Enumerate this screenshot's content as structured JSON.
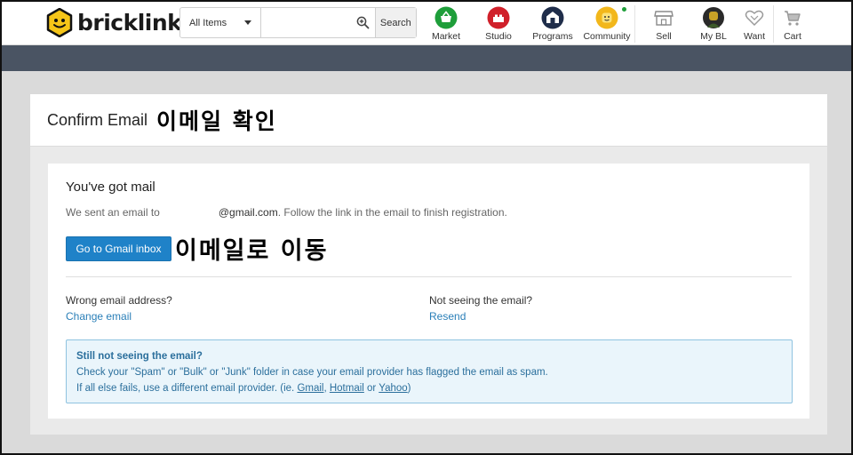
{
  "brand": {
    "name": "bricklink"
  },
  "search": {
    "category": "All Items",
    "value": "",
    "button_label": "Search"
  },
  "nav": {
    "market": "Market",
    "studio": "Studio",
    "programs": "Programs",
    "community": "Community",
    "sell": "Sell",
    "my_bl": "My BL",
    "want": "Want",
    "cart": "Cart"
  },
  "page": {
    "title": "Confirm Email",
    "title_annotation": "이메일 확인"
  },
  "confirm": {
    "heading": "You've got mail",
    "sent_prefix": "We sent an email to",
    "sent_domain": "@gmail.com",
    "sent_suffix": ". Follow the link in the email to finish registration.",
    "gmail_button": "Go to Gmail inbox",
    "gmail_annotation": "이메일로 이동",
    "wrong_email_q": "Wrong email address?",
    "change_email": "Change email",
    "not_seeing_q": "Not seeing the email?",
    "resend": "Resend"
  },
  "notice": {
    "title": "Still not seeing the email?",
    "line1": "Check your \"Spam\" or \"Bulk\" or \"Junk\" folder in case your email provider has flagged the email as spam.",
    "line2_prefix": "If all else fails, use a different email provider. (ie. ",
    "gmail": "Gmail",
    "sep1": ", ",
    "hotmail": "Hotmail",
    "sep2": " or ",
    "yahoo": "Yahoo",
    "line2_suffix": ")"
  },
  "colors": {
    "primary_button": "#1f82c8",
    "link": "#2a7fb8",
    "nav_bar": "#4a5463",
    "notice_bg": "#eaf5fb",
    "market_icon": "#1e9e3a",
    "studio_icon": "#d0202a",
    "programs_icon": "#1f2d4a",
    "community_icon": "#f2b71b",
    "brand_yellow": "#f5c518"
  },
  "icons": {
    "logo": "brick-logo-icon",
    "zoom": "zoom-in-icon",
    "market": "basket-icon",
    "studio": "brick-icon",
    "programs": "house-brick-icon",
    "community": "minifig-face-icon",
    "sell": "storefront-icon",
    "my_bl": "avatar",
    "want": "heart-icon",
    "cart": "cart-icon"
  }
}
